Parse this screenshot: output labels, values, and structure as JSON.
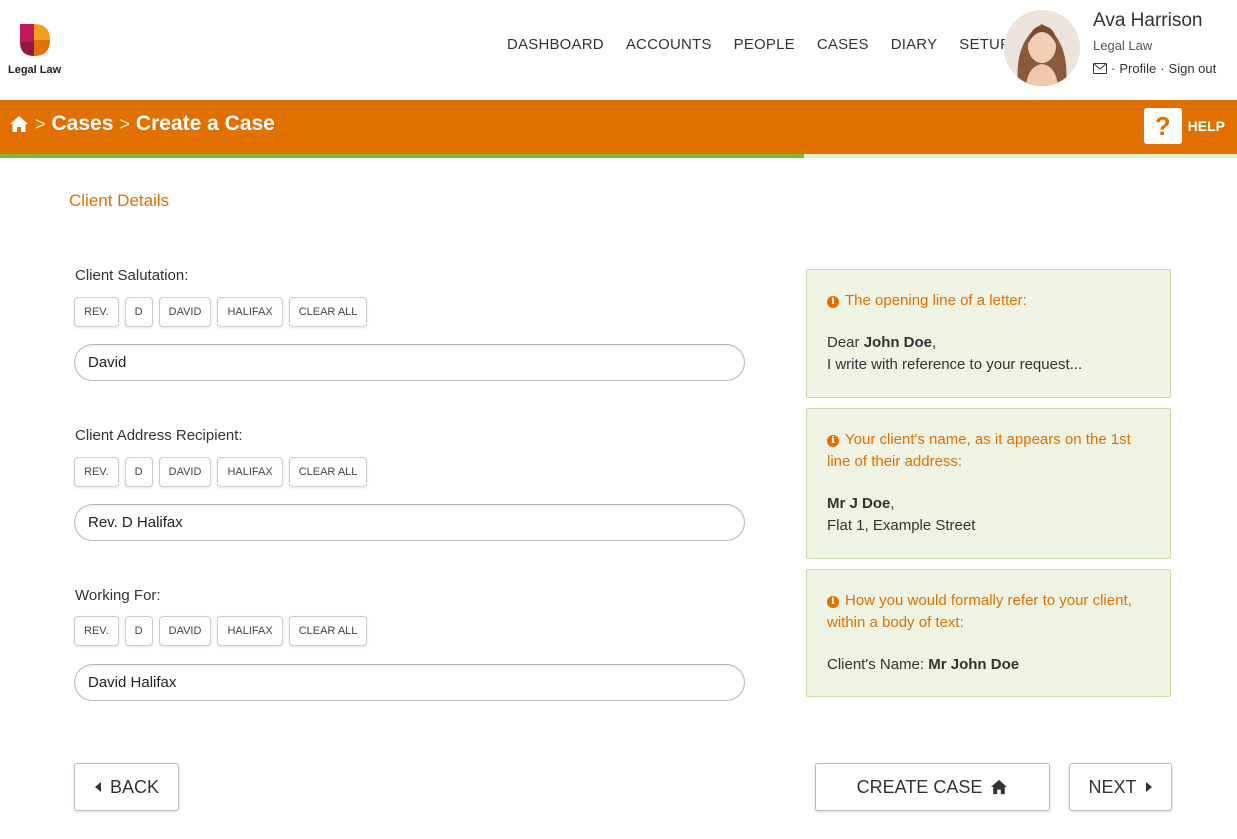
{
  "brand": {
    "name": "Legal Law",
    "colors": {
      "accent": "#e07000",
      "progress": "#7cb82f"
    }
  },
  "nav": [
    {
      "label": "DASHBOARD"
    },
    {
      "label": "ACCOUNTS"
    },
    {
      "label": "PEOPLE"
    },
    {
      "label": "CASES"
    },
    {
      "label": "DIARY"
    },
    {
      "label": "SETUP"
    }
  ],
  "user": {
    "name": "Ava Harrison",
    "org": "Legal Law",
    "profile_label": "Profile",
    "signout_label": "Sign out",
    "sep": "·"
  },
  "breadcrumb": {
    "home_icon": "home-icon",
    "sep": ">",
    "items": [
      "Cases",
      "Create a Case"
    ]
  },
  "help": {
    "icon": "?",
    "label": "HELP"
  },
  "progress": {
    "fraction": 0.65
  },
  "section_title": "Client Details",
  "fields": [
    {
      "label": "Client Salutation:",
      "chips": [
        "REV.",
        "D",
        "DAVID",
        "HALIFAX",
        "CLEAR ALL"
      ],
      "value": "David"
    },
    {
      "label": "Client Address Recipient:",
      "chips": [
        "REV.",
        "D",
        "DAVID",
        "HALIFAX",
        "CLEAR ALL"
      ],
      "value": "Rev. D Halifax"
    },
    {
      "label": "Working For:",
      "chips": [
        "REV.",
        "D",
        "DAVID",
        "HALIFAX",
        "CLEAR ALL"
      ],
      "value": "David Halifax"
    }
  ],
  "cards": [
    {
      "title": "The opening line of a letter:",
      "line1_prefix": "Dear ",
      "line1_bold": "John Doe",
      "line1_suffix": ",",
      "line2": "I write with reference to your request..."
    },
    {
      "title": "Your client's name, as it appears on the 1st line of their address:",
      "line1_prefix": "",
      "line1_bold": "Mr J Doe",
      "line1_suffix": ",",
      "line2": "Flat 1, Example Street"
    },
    {
      "title": "How you would formally refer to your client, within a body of text:",
      "line1_prefix": "Client's Name: ",
      "line1_bold": "Mr John Doe",
      "line1_suffix": "",
      "line2": ""
    }
  ],
  "buttons": {
    "back": "BACK",
    "create": "CREATE CASE",
    "next": "NEXT"
  }
}
